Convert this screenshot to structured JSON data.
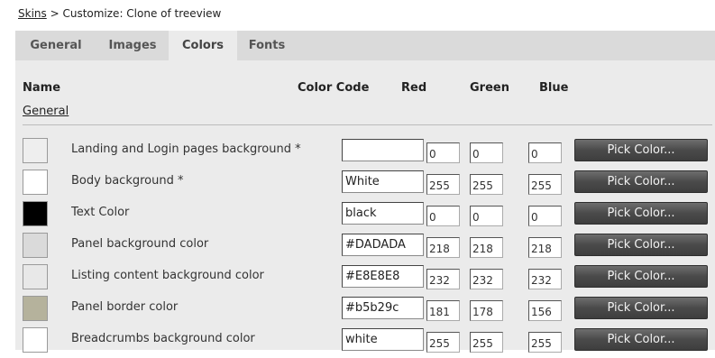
{
  "breadcrumb": {
    "link": "Skins",
    "separator": " > ",
    "current": "Customize: Clone of treeview"
  },
  "tabs": [
    {
      "label": "General"
    },
    {
      "label": "Images"
    },
    {
      "label": "Colors",
      "active": true
    },
    {
      "label": "Fonts"
    }
  ],
  "columns": {
    "name": "Name",
    "code": "Color Code",
    "red": "Red",
    "green": "Green",
    "blue": "Blue"
  },
  "section": {
    "label": "General"
  },
  "rows": [
    {
      "name": "Landing and Login pages background *",
      "code": "",
      "red": "0",
      "green": "0",
      "blue": "0",
      "swatch": "#eeeeee",
      "pick": "Pick Color..."
    },
    {
      "name": "Body background *",
      "code": "White",
      "red": "255",
      "green": "255",
      "blue": "255",
      "swatch": "#ffffff",
      "pick": "Pick Color..."
    },
    {
      "name": "Text Color",
      "code": "black",
      "red": "0",
      "green": "0",
      "blue": "0",
      "swatch": "#000000",
      "pick": "Pick Color..."
    },
    {
      "name": "Panel background color",
      "code": "#DADADA",
      "red": "218",
      "green": "218",
      "blue": "218",
      "swatch": "#dadada",
      "pick": "Pick Color..."
    },
    {
      "name": "Listing content background color",
      "code": "#E8E8E8",
      "red": "232",
      "green": "232",
      "blue": "232",
      "swatch": "#e8e8e8",
      "pick": "Pick Color..."
    },
    {
      "name": "Panel border color",
      "code": "#b5b29c",
      "red": "181",
      "green": "178",
      "blue": "156",
      "swatch": "#b5b29c",
      "pick": "Pick Color..."
    },
    {
      "name": "Breadcrumbs background color",
      "code": "white",
      "red": "255",
      "green": "255",
      "blue": "255",
      "swatch": "#ffffff",
      "pick": "Pick Color..."
    }
  ]
}
